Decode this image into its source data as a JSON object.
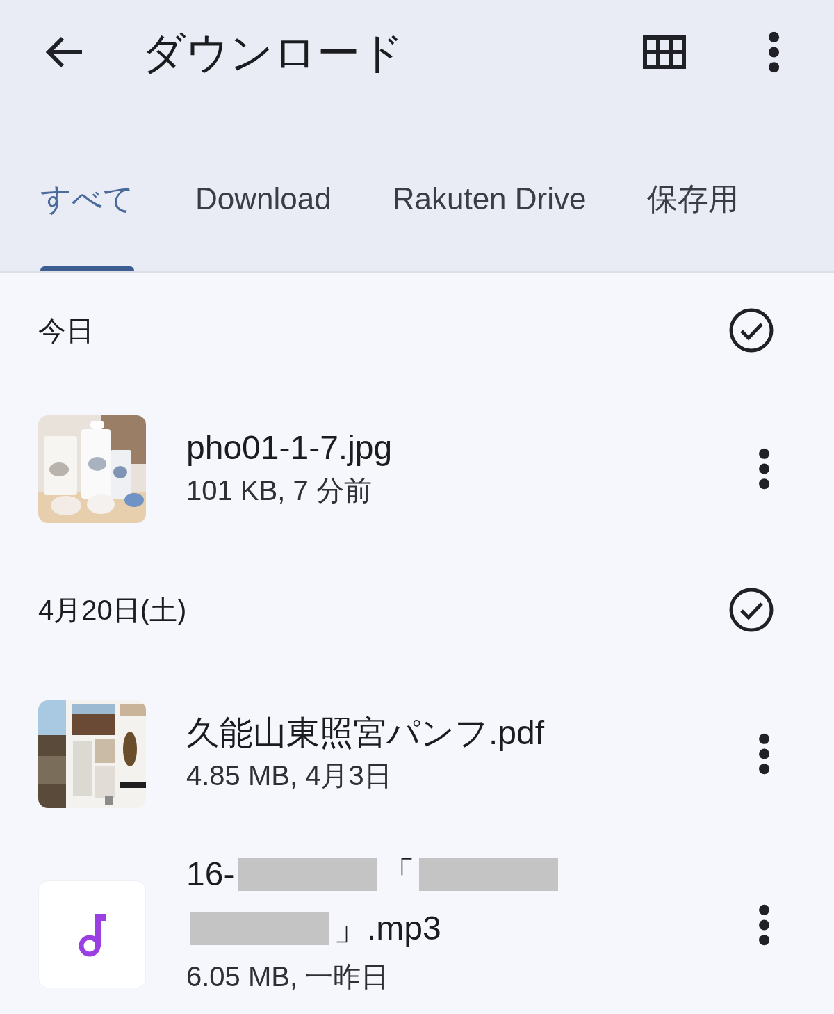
{
  "header": {
    "title": "ダウンロード"
  },
  "tabs": [
    {
      "label": "すべて",
      "selected": true
    },
    {
      "label": "Download",
      "selected": false
    },
    {
      "label": "Rakuten Drive",
      "selected": false
    },
    {
      "label": "保存用",
      "selected": false
    }
  ],
  "groups": [
    {
      "heading": "今日",
      "files": [
        {
          "name_lines": [
            [
              {
                "kind": "text",
                "text": "pho01-1-7.jpg"
              }
            ]
          ],
          "meta": "101 KB, 7 分前"
        }
      ]
    },
    {
      "heading": "4月20日(土)",
      "files": [
        {
          "kind": "document",
          "name_lines": [
            [
              {
                "kind": "text",
                "text": "久能山東照宮パンフ.pdf"
              }
            ]
          ],
          "meta": "4.85 MB, 4月3日"
        },
        {
          "kind": "audio",
          "name_lines": [
            [
              {
                "kind": "text",
                "text": "16-"
              },
              {
                "kind": "redacted"
              },
              {
                "kind": "text",
                "text": "「"
              },
              {
                "kind": "redacted"
              }
            ],
            [
              {
                "kind": "redacted"
              },
              {
                "kind": "text",
                "text": "」.mp3"
              }
            ]
          ],
          "meta": "6.05 MB, 一昨日"
        }
      ]
    }
  ]
}
